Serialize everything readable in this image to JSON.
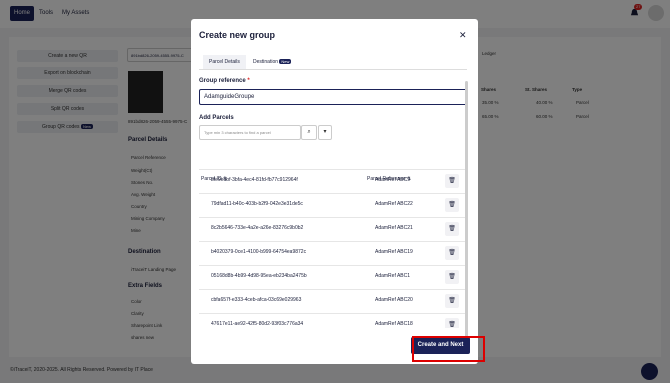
{
  "nav": {
    "home": "Home",
    "tools": "Tools",
    "assets": "My Assets",
    "notif_count": "27"
  },
  "sidebar": {
    "buttons": [
      "Create a new QR",
      "Export on blockchain",
      "Merge QR codes",
      "Split QR codes",
      "Group QR codes"
    ],
    "group_new": "New",
    "qr_id_input": "891bd826-2059-4555-9975-C",
    "qr_id_text": "891bd826-2059-4555-9975-C"
  },
  "details": {
    "parcel_title": "Parcel Details",
    "fields": [
      "Parcel Reference",
      "Weight(Ct)",
      "Stones No.",
      "Avg. Weight",
      "Country",
      "Mining Company",
      "Mine"
    ],
    "destination_title": "Destination",
    "dest_field": "iTraceiT Landing Page",
    "extra_title": "Extra Fields",
    "extra_fields": [
      "Color",
      "Clarity",
      "Sharepoint Link",
      "shares new"
    ]
  },
  "table_bg": {
    "ledger": "Ledger",
    "headers": [
      "Shares",
      "St. Shares",
      "Type"
    ],
    "rows": [
      [
        "35.00 %",
        "40.00 %",
        "Parcel"
      ],
      [
        "65.00 %",
        "60.00 %",
        "Parcel"
      ]
    ]
  },
  "footer": "©iTraceiT, 2020-2025. All Rights Reserved. Powered by IT Place",
  "modal": {
    "title": "Create new group",
    "tabs": {
      "details": "Parcel Details",
      "destination": "Destination",
      "new": "New"
    },
    "group_ref_label": "Group reference",
    "required": "*",
    "group_ref_value": "AdamguideGroupe",
    "add_parcels_label": "Add Parcels",
    "search_placeholder": "Type min 3 characters to find a parcel",
    "col_id": "Parcel ID",
    "col_ref": "Parcel Reference",
    "rows": [
      {
        "id": "bfe9edbf-3bfa-4ec4-81fd-fb77c912964f",
        "ref": "AdamRef ABC9"
      },
      {
        "id": "79dfad11-b40c-403b-b2f9-042e3e31de5c",
        "ref": "AdamRef ABC22"
      },
      {
        "id": "8c2b5646-733e-4a2e-a26e-83276c9b0b2",
        "ref": "AdamRef ABC21"
      },
      {
        "id": "b4020379-0ce1-4100-b999-64754ea9872c",
        "ref": "AdamRef ABC19"
      },
      {
        "id": "05168d8b-4b99-4d98-95ea-eb234ba2475b",
        "ref": "AdamRef ABC1"
      },
      {
        "id": "cbfa657f-e333-4ceb-afca-03c69e029963",
        "ref": "AdamRef ABC20"
      },
      {
        "id": "47617e11-ae92-42f5-80d2-93f03c776a34",
        "ref": "AdamRef ABC18"
      }
    ],
    "next": "Create and Next"
  }
}
